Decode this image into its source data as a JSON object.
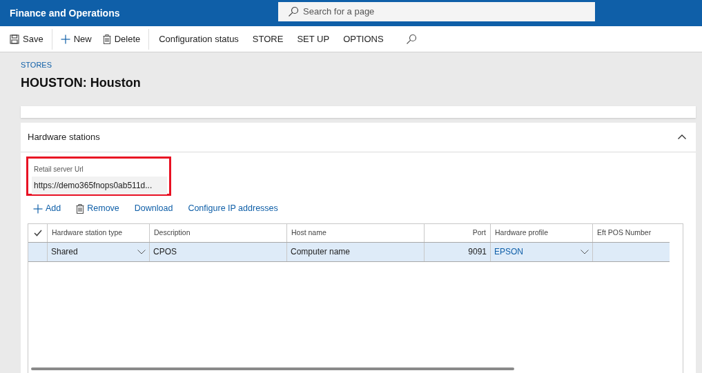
{
  "app_bar": {
    "title": "Finance and Operations",
    "search": {
      "placeholder": "Search for a page"
    }
  },
  "toolbar": [
    {
      "kind": "save",
      "label": "Save"
    },
    {
      "kind": "new",
      "label": "New"
    },
    {
      "kind": "delete",
      "label": "Delete"
    },
    {
      "kind": "divider"
    },
    {
      "kind": "text",
      "label": "Configuration status"
    },
    {
      "kind": "text",
      "label": "STORE"
    },
    {
      "kind": "text",
      "label": "SET UP"
    },
    {
      "kind": "text",
      "label": "OPTIONS"
    },
    {
      "kind": "search"
    }
  ],
  "breadcrumb": "STORES",
  "page_title": "HOUSTON: Houston",
  "section": {
    "title": "Hardware stations",
    "expanded": true,
    "field": {
      "label": "Retail server Url",
      "value": "https://demo365fnops0ab511d...",
      "highlighted": true
    },
    "actions": [
      {
        "kind": "add",
        "label": "Add"
      },
      {
        "kind": "remove",
        "label": "Remove"
      },
      {
        "kind": "text",
        "label": "Download"
      },
      {
        "kind": "text",
        "label": "Configure IP addresses"
      }
    ],
    "table": {
      "columns": [
        {
          "label": "Hardware station type"
        },
        {
          "label": "Description"
        },
        {
          "label": "Host name"
        },
        {
          "label": "Port"
        },
        {
          "label": "Hardware profile"
        },
        {
          "label": "Eft POS Number"
        }
      ],
      "rows": [
        {
          "selected": true,
          "cells": [
            {
              "kind": "dropdown",
              "text": "Shared"
            },
            {
              "kind": "text",
              "text": "CPOS"
            },
            {
              "kind": "text",
              "text": "Computer name"
            },
            {
              "kind": "number",
              "text": "9091"
            },
            {
              "kind": "link_dropdown",
              "text": "EPSON"
            },
            {
              "kind": "empty"
            }
          ]
        }
      ]
    }
  }
}
